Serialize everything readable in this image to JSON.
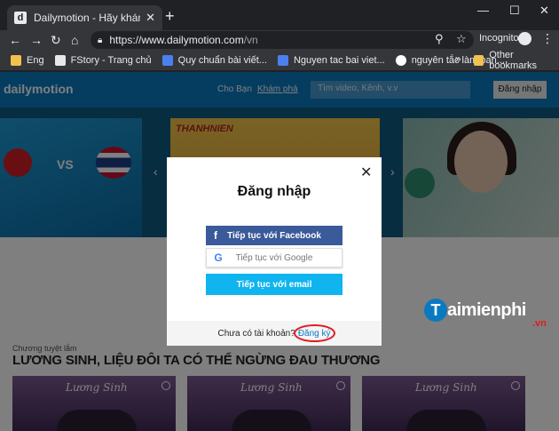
{
  "browser": {
    "tab_title": "Dailymotion - Hãy khám phá và x",
    "tab_favicon": "d",
    "url_host": "https://www.dailymotion.com",
    "url_path": "/vn",
    "incognito_label": "Incognito",
    "bookmarks": [
      {
        "label": "Eng",
        "icon": "folder-icon",
        "color": "#f2c14e"
      },
      {
        "label": "FStory - Trang chủ",
        "icon": "fstory-icon",
        "color": "#e8e8e8"
      },
      {
        "label": "Quy chuẩn bài viết...",
        "icon": "docs-icon",
        "color": "#4a80f0"
      },
      {
        "label": "Nguyen tac bai viet...",
        "icon": "docs-icon",
        "color": "#4a80f0"
      },
      {
        "label": "nguyên tắc làm ban...",
        "icon": "google-icon",
        "color": "#ffffff"
      }
    ],
    "other_bookmarks": "Other bookmarks"
  },
  "site": {
    "logo": "dailymotion",
    "nav": [
      "Cho Bạn",
      "Khám phá"
    ],
    "search_placeholder": "Tìm video, Kênh, v.v",
    "login_button": "Đăng nhập",
    "carousel_brand": "THANHNIEN",
    "section_label": "Chương tuyệt lắm",
    "section_title": "LƯƠNG SINH, LIỆU ĐÔI TA CÓ THỂ NGỪNG ĐAU THƯƠNG",
    "thumb_title": "Lương Sinh"
  },
  "modal": {
    "title": "Đăng nhập",
    "facebook_button": "Tiếp tục với Facebook",
    "google_button": "Tiếp tục với Google",
    "email_button": "Tiếp tục với email",
    "footer_text": "Chưa có tài khoản?",
    "signup_link": "Đăng ký"
  },
  "watermark": {
    "brand": "aimienphi",
    "brand_initial": "T",
    "suffix": ".vn"
  }
}
